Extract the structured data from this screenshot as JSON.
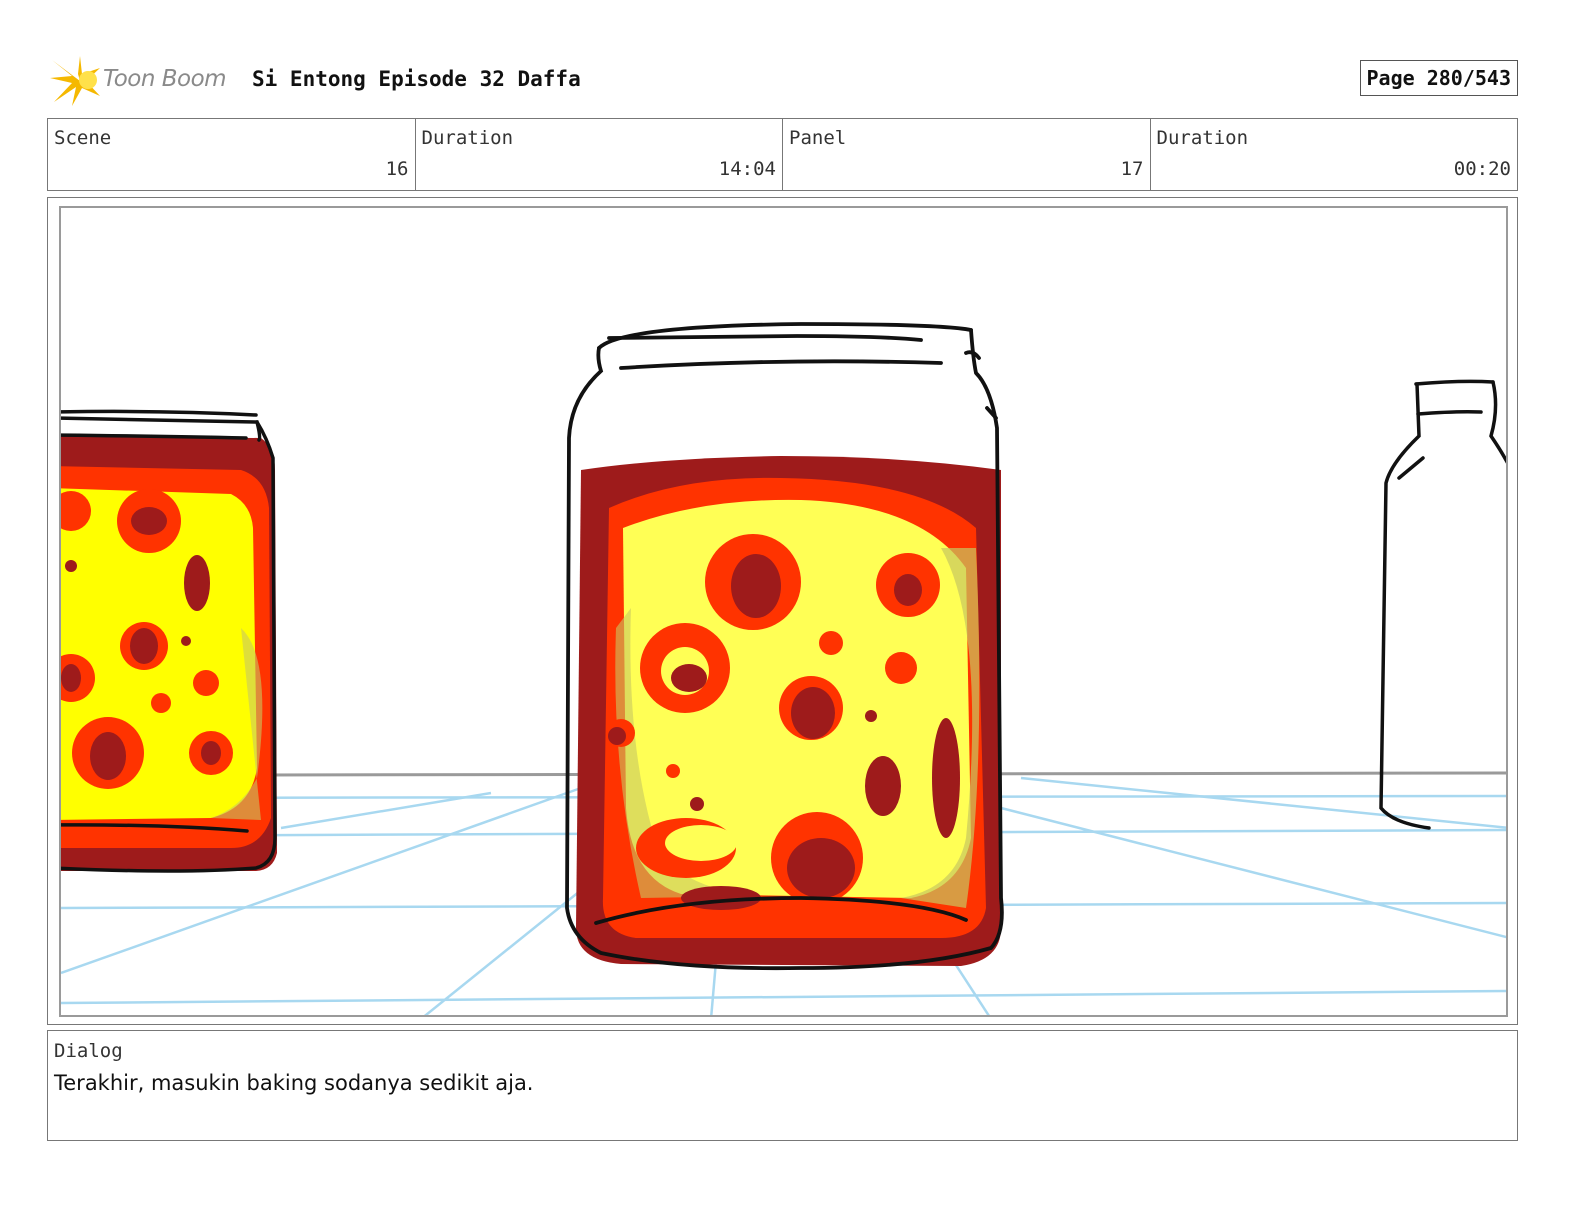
{
  "header": {
    "logo_text": "Toon Boom",
    "title": "Si Entong Episode 32 Daffa",
    "page": "Page 280/543"
  },
  "info": {
    "scene_label": "Scene",
    "scene_value": "16",
    "scene_duration_label": "Duration",
    "scene_duration_value": "14:04",
    "panel_label": "Panel",
    "panel_value": "17",
    "panel_duration_label": "Duration",
    "panel_duration_value": "00:20"
  },
  "dialog": {
    "label": "Dialog",
    "text": "Terakhir, masukin baking sodanya sedikit aja."
  },
  "colors": {
    "liquid_dark": "#9e1b1b",
    "liquid_orange": "#ff3300",
    "liquid_yellow": "#ffff55",
    "grid_blue": "#a8d8f0",
    "logo_star": "#f5c518"
  }
}
